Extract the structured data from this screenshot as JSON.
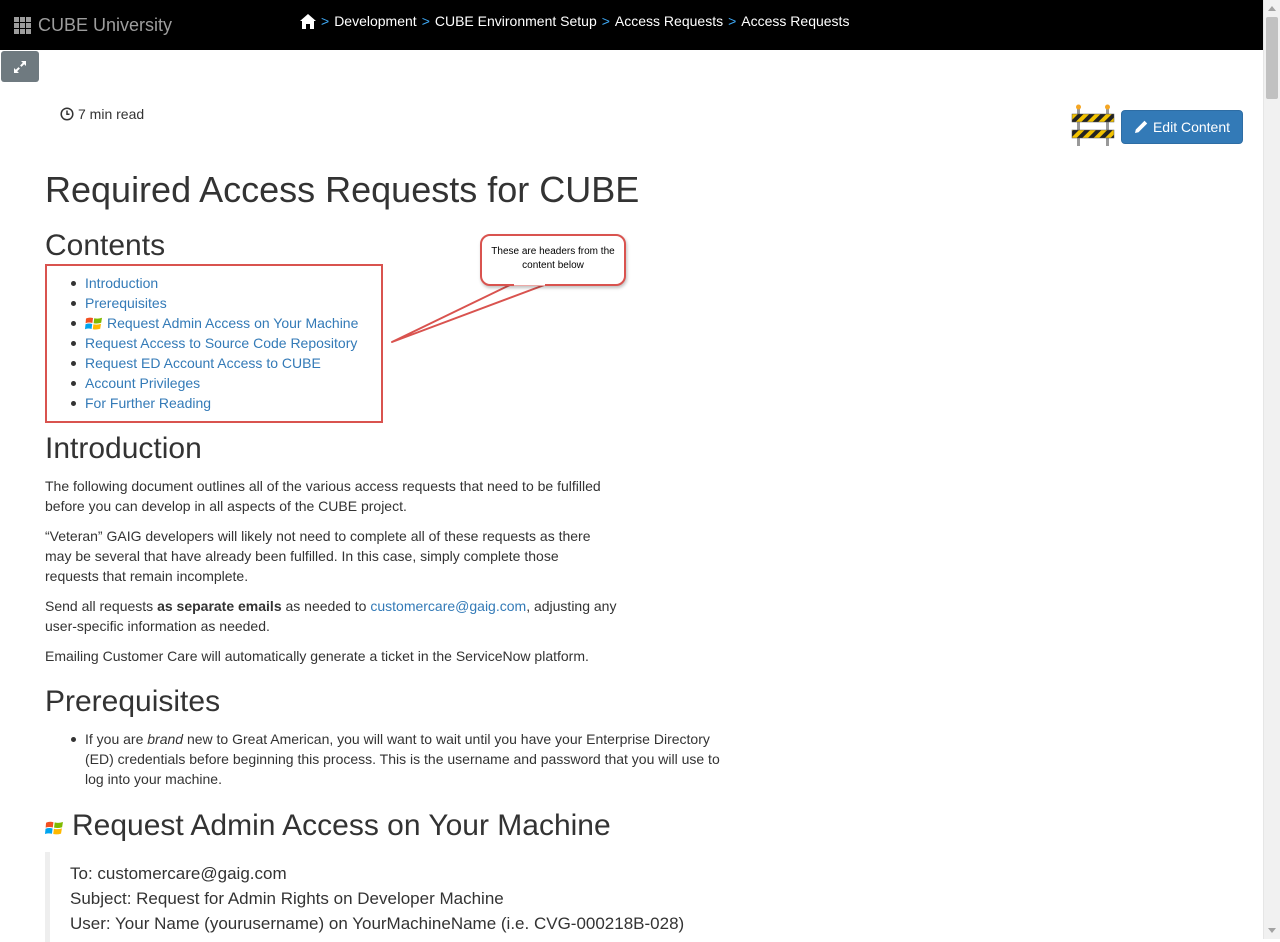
{
  "header": {
    "brand": "CUBE University",
    "breadcrumb": [
      "Development",
      "CUBE Environment Setup",
      "Access Requests",
      "Access Requests"
    ],
    "separator": ">"
  },
  "meta": {
    "read_time": "7 min read"
  },
  "toolbar": {
    "edit_label": "Edit Content"
  },
  "page": {
    "title": "Required Access Requests for CUBE",
    "contents_heading": "Contents",
    "toc": [
      "Introduction",
      "Prerequisites",
      "Request Admin Access on Your Machine",
      "Request Access to Source Code Repository",
      "Request ED Account Access to CUBE",
      "Account Privileges",
      "For Further Reading"
    ],
    "callout": "These are headers from the content below",
    "intro": {
      "heading": "Introduction",
      "p1": "The following document outlines all of the various access requests that need to be fulfilled before you can develop in all aspects of the CUBE project.",
      "p2": "“Veteran” GAIG developers will likely not need to complete all of these requests as there may be several that have already been fulfilled. In this case, simply complete those requests that remain incomplete.",
      "p3_a": "Send all requests ",
      "p3_bold": "as separate emails",
      "p3_b": " as needed to ",
      "p3_link": "customercare@gaig.com",
      "p3_c": ", adjusting any user-specific information as needed.",
      "p4": "Emailing Customer Care will automatically generate a ticket in the ServiceNow platform."
    },
    "prereq": {
      "heading": "Prerequisites",
      "b_a": "If you are ",
      "b_em": "brand",
      "b_b": " new to Great American, you will want to wait until you have your Enterprise Directory (ED) credentials before beginning this process. This is the username and password that you will use to log into your machine."
    },
    "admin": {
      "heading": "Request Admin Access on Your Machine",
      "to": "To: customercare@gaig.com",
      "subject": "Subject: Request for Admin Rights on Developer Machine",
      "user": "User: Your Name (yourusername) on YourMachineName (i.e. CVG-000218B-028)"
    }
  },
  "colors": {
    "topbar": "#000000",
    "link": "#337ab7",
    "breadcrumb_separator": "#3fa9f5",
    "annotation_red": "#d9534f",
    "button_primary": "#337ab7"
  },
  "icons": [
    "apps-grid-icon",
    "home-icon",
    "expand-icon",
    "clock-icon",
    "construction-barrier-icon",
    "pencil-icon",
    "windows-logo-icon"
  ]
}
